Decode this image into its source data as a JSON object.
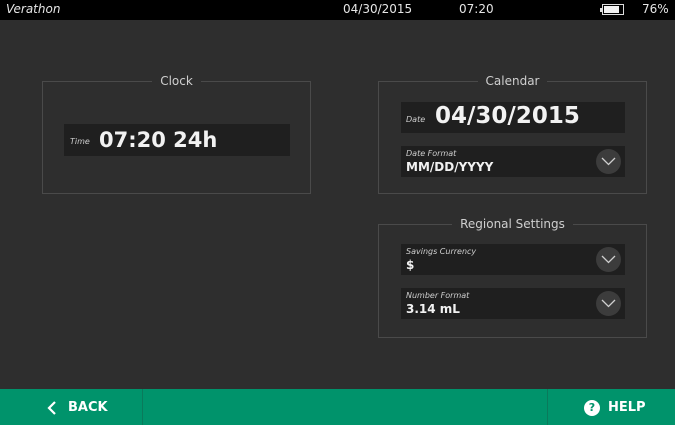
{
  "status": {
    "brand": "Verathon",
    "date": "04/30/2015",
    "time": "07:20",
    "battery_percent": "76%",
    "battery_level": 0.76
  },
  "clock": {
    "title": "Clock",
    "time_label": "Time",
    "time_value": "07:20 24h"
  },
  "calendar": {
    "title": "Calendar",
    "date_label": "Date",
    "date_value": "04/30/2015",
    "format_label": "Date Format",
    "format_value": "MM/DD/YYYY"
  },
  "regional": {
    "title": "Regional Settings",
    "currency_label": "Savings Currency",
    "currency_value": "$",
    "number_label": "Number Format",
    "number_value": "3.14 mL"
  },
  "footer": {
    "back_label": "BACK",
    "help_label": "HELP",
    "help_icon": "?"
  },
  "colors": {
    "footer": "#00936b",
    "background": "#2e2e2e",
    "field": "#1f1f1f"
  }
}
